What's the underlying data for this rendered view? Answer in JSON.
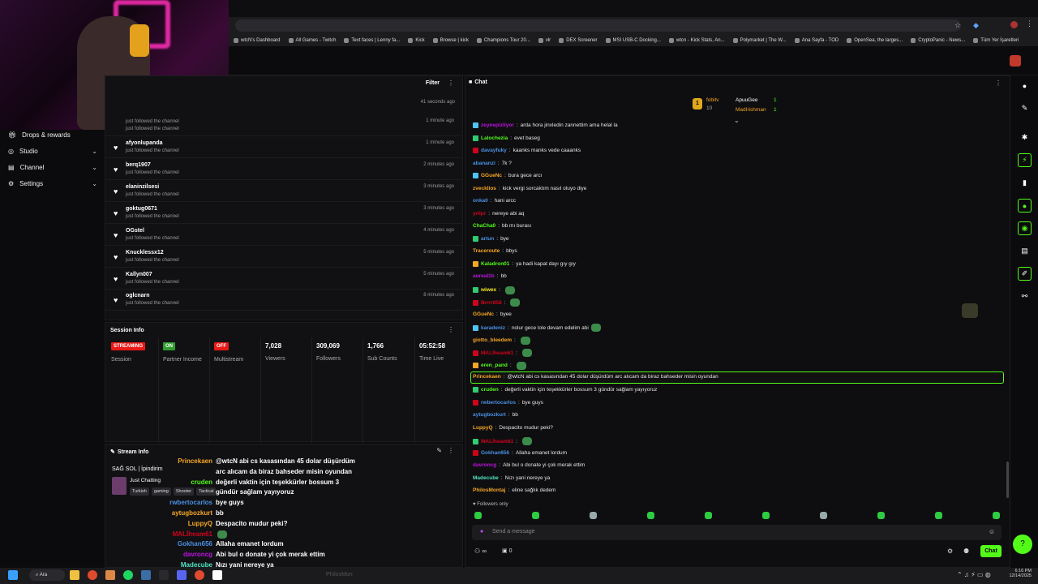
{
  "browser": {
    "bookmarks": [
      "wtcN's Dashboard",
      "All Games - Twitch",
      "Text faces | Lenny fa...",
      "Kick",
      "Browse | kick",
      "Champions Tour 20...",
      "vlr",
      "DEX Screener",
      "MSI USB-C Docking...",
      "wtcn - Kick Stats, An...",
      "Polymarket | The W...",
      "Ana Sayfa - TOD",
      "OpenSea, the larges...",
      "CryptoPanic - News...",
      "Tüm Yer İşaretleri"
    ]
  },
  "sidebar": {
    "items": [
      {
        "label": "Drops & rewards",
        "icon": "gift-icon"
      },
      {
        "label": "Studio",
        "icon": "studio-icon"
      },
      {
        "label": "Channel",
        "icon": "channel-icon"
      },
      {
        "label": "Settings",
        "icon": "gear-icon"
      }
    ]
  },
  "activity": {
    "filter_label": "Filter",
    "first_time": "41 seconds ago",
    "first_sub": "just followed the channel",
    "rows": [
      {
        "name": "",
        "sub": "just followed the channel",
        "time": "1 minute ago"
      },
      {
        "name": "afyonlupanda",
        "sub": "just followed the channel",
        "time": "1 minute ago"
      },
      {
        "name": "berq1907",
        "sub": "just followed the channel",
        "time": "2 minutes ago"
      },
      {
        "name": "elaninzilsesi",
        "sub": "just followed the channel",
        "time": "3 minutes ago"
      },
      {
        "name": "goktug0671",
        "sub": "just followed the channel",
        "time": "3 minutes ago"
      },
      {
        "name": "OGstel",
        "sub": "just followed the channel",
        "time": "4 minutes ago"
      },
      {
        "name": "Knucklessx12",
        "sub": "just followed the channel",
        "time": "5 minutes ago"
      },
      {
        "name": "Kallyn007",
        "sub": "just followed the channel",
        "time": "5 minutes ago"
      },
      {
        "name": "oglcnarn",
        "sub": "just followed the channel",
        "time": "8 minutes ago"
      }
    ]
  },
  "session": {
    "title": "Session Info",
    "stats": [
      {
        "badge": "STREAMING",
        "badge_color": "#e91916",
        "label": "Session"
      },
      {
        "badge": "ON",
        "badge_color": "#2f9e2f",
        "label": "Partner Income"
      },
      {
        "badge": "OFF",
        "badge_color": "#e91916",
        "label": "Multistream"
      },
      {
        "value": "7,028",
        "label": "Viewers"
      },
      {
        "value": "309,069",
        "label": "Followers"
      },
      {
        "value": "1,766",
        "label": "Sub Counts"
      },
      {
        "value": "05:52:58",
        "label": "Time Live"
      }
    ]
  },
  "stream_info": {
    "title": "Stream Info",
    "stream_title": "SAĞ SOL | İpindirim",
    "category": "Just Chatting",
    "tags": [
      "Turkish",
      "gaming",
      "Shooter",
      "Tactical"
    ]
  },
  "overlay_chat": [
    {
      "user": "Princekaen",
      "color": "#f5a623",
      "text": "@wtcN abi cs kasasından 45 dolar düşürdüm"
    },
    {
      "user": "",
      "color": "#ffffff",
      "text": "arc alıcam da biraz bahseder misin oyundan"
    },
    {
      "user": "cruden",
      "color": "#53fc18",
      "text": "değerli vaktin için teşekkürler bossum 3"
    },
    {
      "user": "",
      "color": "#ffffff",
      "text": "gündür sağlam yayıyoruz"
    },
    {
      "user": "rwbertocarlos",
      "color": "#4a90e2",
      "text": "bye guys"
    },
    {
      "user": "aytugbozkurt",
      "color": "#f5a623",
      "text": "bb"
    },
    {
      "user": "LuppyQ",
      "color": "#f5a623",
      "text": "Despacito mudur peki?"
    },
    {
      "user": "MALİheam61",
      "color": "#d0021b",
      "text": ""
    },
    {
      "user": "Gokhan656",
      "color": "#4a90e2",
      "text": "Allaha emanet lordum"
    },
    {
      "user": "davroncg",
      "color": "#bd10e0",
      "text": "Abi bul o donate yi çok merak ettim"
    },
    {
      "user": "Madecube",
      "color": "#50e3c2",
      "text": "Nızı yani nereye ya"
    }
  ],
  "chat": {
    "title": "Chat",
    "top_gifters": [
      {
        "rank": "1",
        "name": "fobitv",
        "count": "10"
      },
      {
        "name": "ApuuGee",
        "count": "1"
      },
      {
        "name": "MadIrishman",
        "count": "1"
      }
    ],
    "messages": [
      {
        "user": "zeynepizliyor",
        "color": "#bd10e0",
        "text": "arda hora jinxledin zannettim ama helal la"
      },
      {
        "user": "Lalochezia",
        "color": "#53fc18",
        "text": "evet baseg"
      },
      {
        "user": "davayfuky",
        "color": "#4a90e2",
        "text": "kaanks manks vede caaanks"
      },
      {
        "user": "abananzi",
        "color": "#4a90e2",
        "text": "7k ?"
      },
      {
        "user": "GGueNc",
        "color": "#f5a623",
        "text": "bura gece arcı"
      },
      {
        "user": "zvecklios",
        "color": "#f5a623",
        "text": "kick vergi sorcaktım nasıl oluyo diye"
      },
      {
        "user": "onka0",
        "color": "#4a90e2",
        "text": "hani arcc"
      },
      {
        "user": "yrlipr",
        "color": "#d0021b",
        "text": "nereye abi aq"
      },
      {
        "user": "ChaCha0",
        "color": "#53fc18",
        "text": "bb mı burası"
      },
      {
        "user": "artun",
        "color": "#4a90e2",
        "text": "bye"
      },
      {
        "user": "Traceroute",
        "color": "#f5a623",
        "text": "bbys"
      },
      {
        "user": "Kaladron01",
        "color": "#53fc18",
        "text": "ya hadi kapat dayı gıy gıy"
      },
      {
        "user": "aureal1b",
        "color": "#bd10e0",
        "text": "bb"
      },
      {
        "user": "wiwex",
        "color": "#f8e71c",
        "text": ""
      },
      {
        "user": "Brrrr858",
        "color": "#d0021b",
        "text": ""
      },
      {
        "user": "GGueNc",
        "color": "#f5a623",
        "text": "byee"
      },
      {
        "user": "karadeniz",
        "color": "#4a90e2",
        "text": "nolur gece lole devam edelim abi"
      },
      {
        "user": "giotto_bleedem",
        "color": "#f5a623",
        "text": ""
      },
      {
        "user": "MALİheam61",
        "color": "#d0021b",
        "text": ""
      },
      {
        "user": "eren_pand",
        "color": "#53fc18",
        "text": ""
      },
      {
        "user": "Princekaen",
        "color": "#f5a623",
        "text": "@wtcN abi cs kasasından 45 dolar düşürdüm arc alıcam da biraz bahseder misin oyundan"
      },
      {
        "user": "cruden",
        "color": "#53fc18",
        "text": "değerli vaktin için teşekkürler bossum 3 gündür sağlam yayıyoruz"
      },
      {
        "user": "rwbertocarlos",
        "color": "#4a90e2",
        "text": "bye guys"
      },
      {
        "user": "aytugbozkurt",
        "color": "#4a90e2",
        "text": "bb"
      },
      {
        "user": "LuppyQ",
        "color": "#f5a623",
        "text": "Despacito mudur peki?"
      },
      {
        "user": "MALİheam61",
        "color": "#d0021b",
        "text": ""
      },
      {
        "user": "Gokhan656",
        "color": "#4a90e2",
        "text": "Allaha emanet lordum"
      },
      {
        "user": "davroncg",
        "color": "#bd10e0",
        "text": "Abi bul o donate yi çok merak ettim"
      },
      {
        "user": "Madecube",
        "color": "#50e3c2",
        "text": "Nızı yani nereye ya"
      },
      {
        "user": "PhilosMontaj",
        "color": "#f5a623",
        "text": "eline sağlık dedem"
      }
    ],
    "followers_only": "Followers only",
    "input_placeholder": "Send a message",
    "viewer_count": "0",
    "send_label": "Chat"
  },
  "taskbar": {
    "search_label": "Ara",
    "overlay_name": "PhilosMon",
    "time": "6:16 PM",
    "date": "12/14/2025"
  },
  "colors": {
    "accent": "#53fc18",
    "live": "#e91916"
  }
}
